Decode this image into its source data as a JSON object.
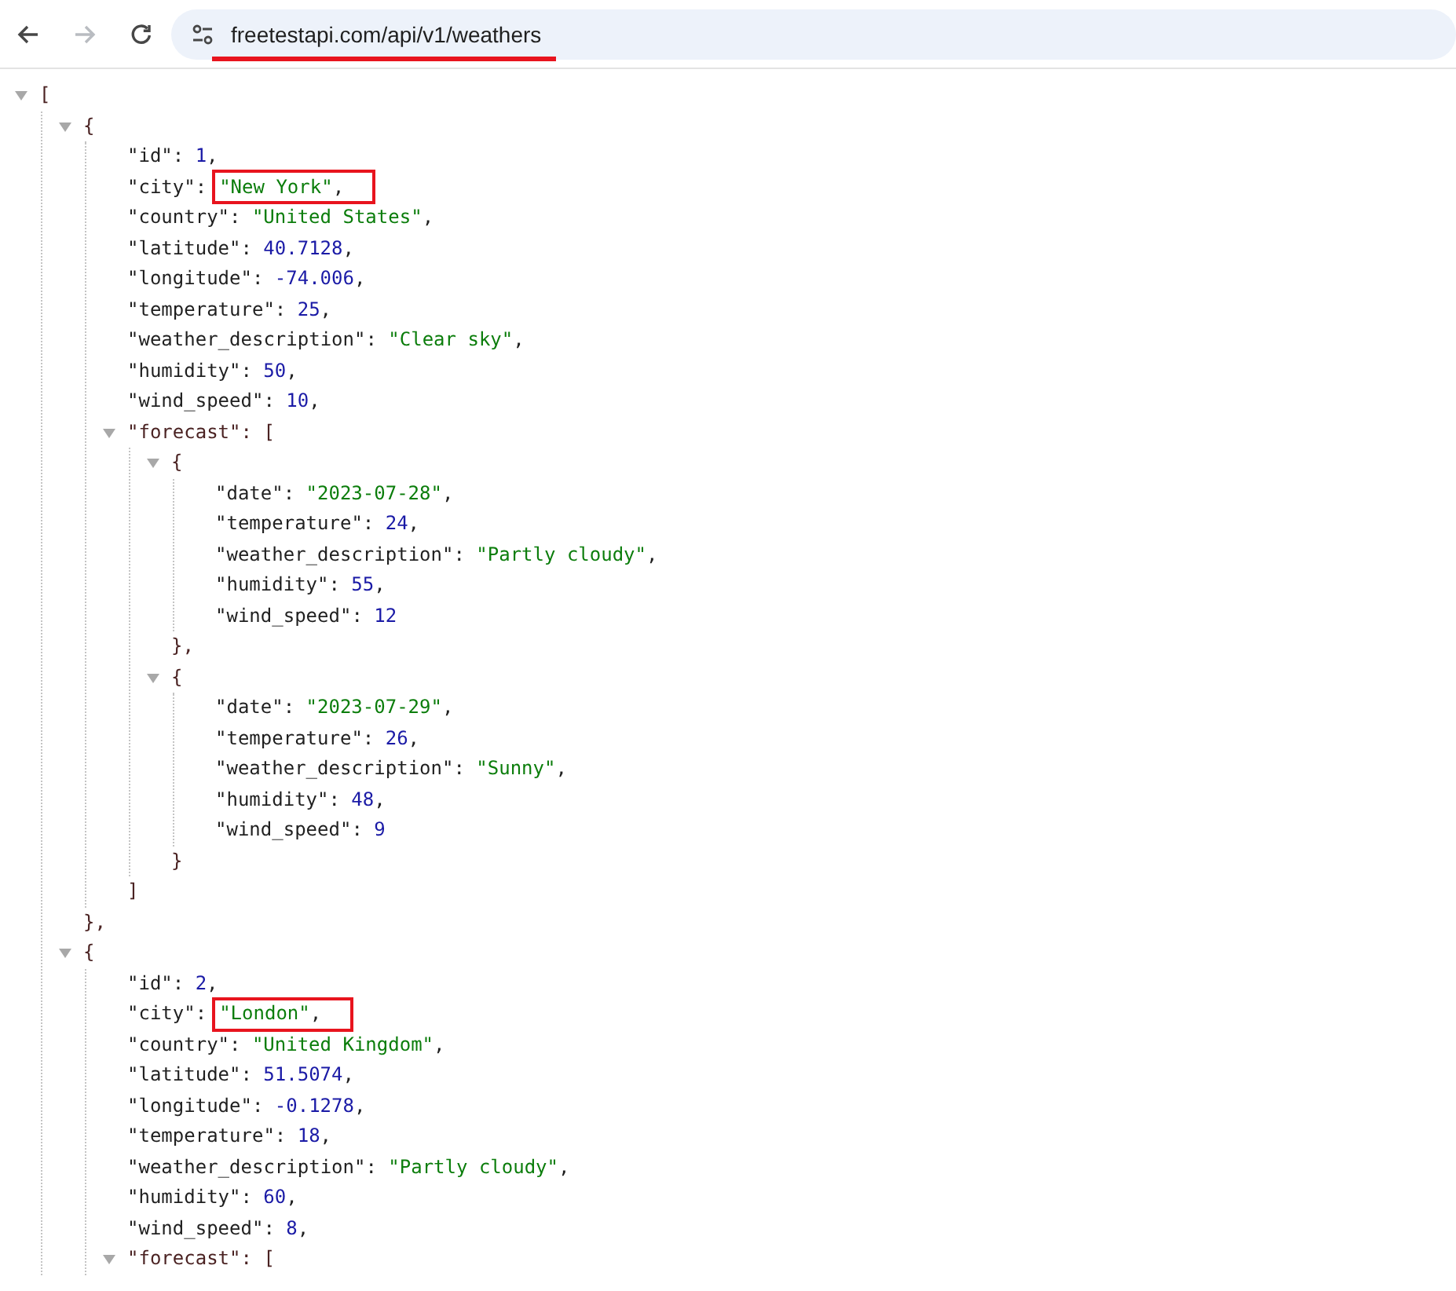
{
  "navigation": {
    "back": {
      "disabled": false
    },
    "forward": {
      "disabled": true
    }
  },
  "address_bar": {
    "url": "freetestapi.com/api/v1/weathers",
    "underlined": true
  },
  "json_tree": {
    "kind": "node",
    "open": "[",
    "expanded": true,
    "children": [
      {
        "kind": "node",
        "open": "{",
        "expanded": true,
        "close": "},",
        "children": [
          {
            "kind": "number",
            "key": "\"id\":",
            "value": "1",
            "suffix": ",",
            "highlighted": false
          },
          {
            "kind": "string",
            "key": "\"city\":",
            "value": "\"New York\"",
            "suffix": ",",
            "highlighted": true
          },
          {
            "kind": "string",
            "key": "\"country\":",
            "value": "\"United States\"",
            "suffix": ",",
            "highlighted": false
          },
          {
            "kind": "number",
            "key": "\"latitude\":",
            "value": "40.7128",
            "suffix": ",",
            "highlighted": false
          },
          {
            "kind": "number",
            "key": "\"longitude\":",
            "value": "-74.006",
            "suffix": ",",
            "highlighted": false
          },
          {
            "kind": "number",
            "key": "\"temperature\":",
            "value": "25",
            "suffix": ",",
            "highlighted": false
          },
          {
            "kind": "string",
            "key": "\"weather_description\":",
            "value": "\"Clear sky\"",
            "suffix": ",",
            "highlighted": false
          },
          {
            "kind": "number",
            "key": "\"humidity\":",
            "value": "50",
            "suffix": ",",
            "highlighted": false
          },
          {
            "kind": "number",
            "key": "\"wind_speed\":",
            "value": "10",
            "suffix": ",",
            "highlighted": false
          },
          {
            "kind": "node",
            "open": "\"forecast\": [",
            "expanded": true,
            "close": "]",
            "children": [
              {
                "kind": "node",
                "open": "{",
                "expanded": true,
                "close": "},",
                "children": [
                  {
                    "kind": "string",
                    "key": "\"date\":",
                    "value": "\"2023-07-28\"",
                    "suffix": ",",
                    "highlighted": false
                  },
                  {
                    "kind": "number",
                    "key": "\"temperature\":",
                    "value": "24",
                    "suffix": ",",
                    "highlighted": false
                  },
                  {
                    "kind": "string",
                    "key": "\"weather_description\":",
                    "value": "\"Partly cloudy\"",
                    "suffix": ",",
                    "highlighted": false
                  },
                  {
                    "kind": "number",
                    "key": "\"humidity\":",
                    "value": "55",
                    "suffix": ",",
                    "highlighted": false
                  },
                  {
                    "kind": "number",
                    "key": "\"wind_speed\":",
                    "value": "12",
                    "highlighted": false
                  }
                ]
              },
              {
                "kind": "node",
                "open": "{",
                "expanded": true,
                "close": "}",
                "children": [
                  {
                    "kind": "string",
                    "key": "\"date\":",
                    "value": "\"2023-07-29\"",
                    "suffix": ",",
                    "highlighted": false
                  },
                  {
                    "kind": "number",
                    "key": "\"temperature\":",
                    "value": "26",
                    "suffix": ",",
                    "highlighted": false
                  },
                  {
                    "kind": "string",
                    "key": "\"weather_description\":",
                    "value": "\"Sunny\"",
                    "suffix": ",",
                    "highlighted": false
                  },
                  {
                    "kind": "number",
                    "key": "\"humidity\":",
                    "value": "48",
                    "suffix": ",",
                    "highlighted": false
                  },
                  {
                    "kind": "number",
                    "key": "\"wind_speed\":",
                    "value": "9",
                    "highlighted": false
                  }
                ]
              }
            ]
          }
        ]
      },
      {
        "kind": "node",
        "open": "{",
        "expanded": true,
        "children": [
          {
            "kind": "number",
            "key": "\"id\":",
            "value": "2",
            "suffix": ",",
            "highlighted": false
          },
          {
            "kind": "string",
            "key": "\"city\":",
            "value": "\"London\"",
            "suffix": ",",
            "highlighted": true
          },
          {
            "kind": "string",
            "key": "\"country\":",
            "value": "\"United Kingdom\"",
            "suffix": ",",
            "highlighted": false
          },
          {
            "kind": "number",
            "key": "\"latitude\":",
            "value": "51.5074",
            "suffix": ",",
            "highlighted": false
          },
          {
            "kind": "number",
            "key": "\"longitude\":",
            "value": "-0.1278",
            "suffix": ",",
            "highlighted": false
          },
          {
            "kind": "number",
            "key": "\"temperature\":",
            "value": "18",
            "suffix": ",",
            "highlighted": false
          },
          {
            "kind": "string",
            "key": "\"weather_description\":",
            "value": "\"Partly cloudy\"",
            "suffix": ",",
            "highlighted": false
          },
          {
            "kind": "number",
            "key": "\"humidity\":",
            "value": "60",
            "suffix": ",",
            "highlighted": false
          },
          {
            "kind": "number",
            "key": "\"wind_speed\":",
            "value": "8",
            "suffix": ",",
            "highlighted": false
          },
          {
            "kind": "node",
            "open": "\"forecast\": [",
            "expanded": true
          }
        ]
      }
    ]
  }
}
